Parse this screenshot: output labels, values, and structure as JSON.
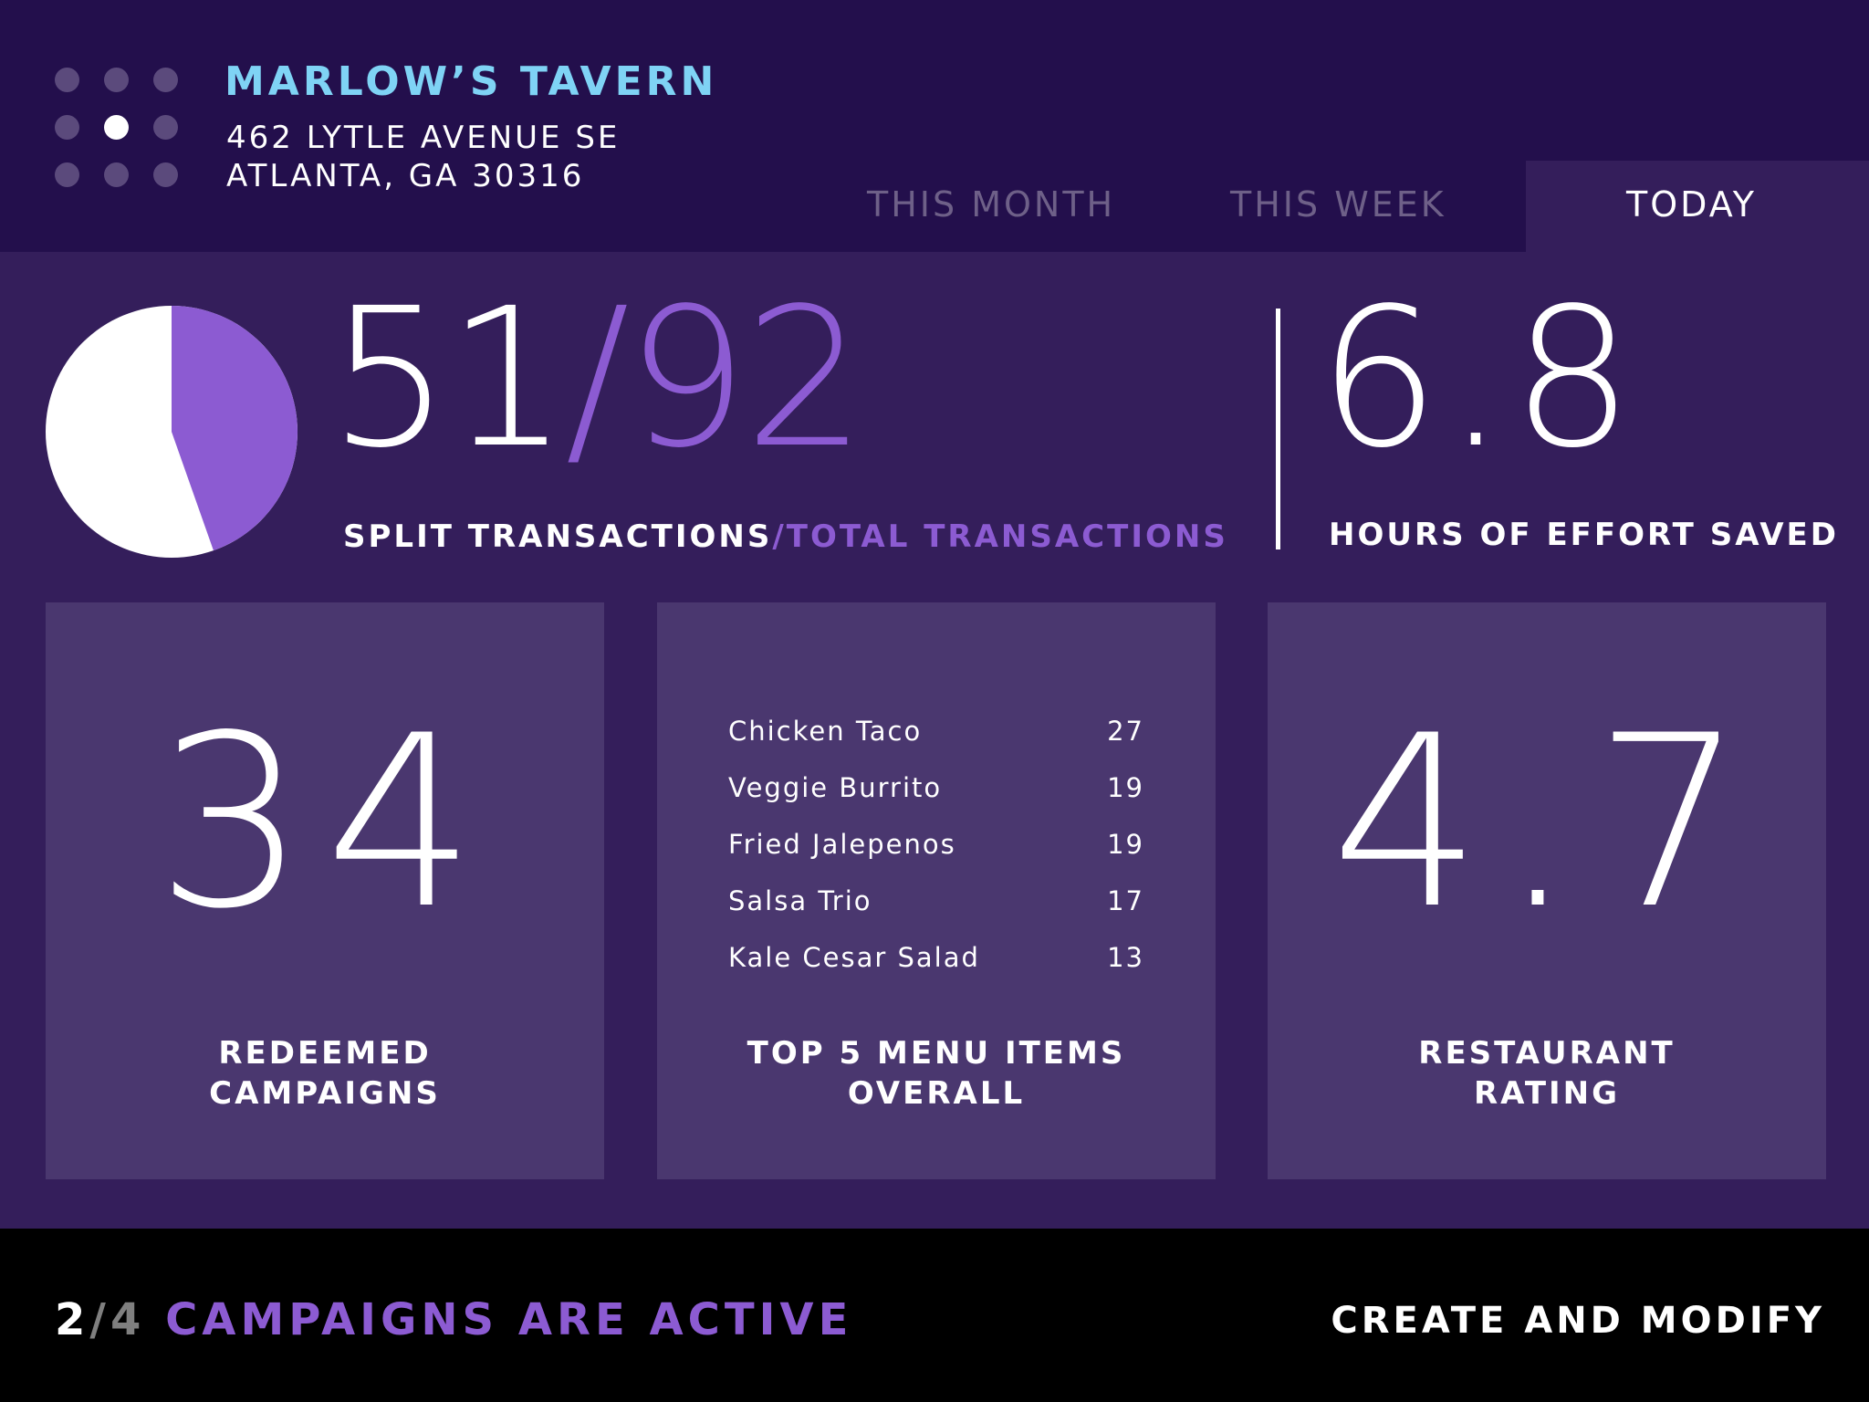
{
  "venue": {
    "name": "MARLOW’S TAVERN",
    "address_line1": "462 LYTLE AVENUE SE",
    "address_line2": "ATLANTA, GA 30316"
  },
  "location_switcher": {
    "total": 9,
    "active_index": 4
  },
  "tabs": [
    {
      "label": "THIS MONTH",
      "selected": false
    },
    {
      "label": "THIS WEEK",
      "selected": false
    },
    {
      "label": "TODAY",
      "selected": true
    }
  ],
  "split_stats": {
    "split": "51",
    "separator": "/",
    "total": "92",
    "label_split": "SPLIT TRANSACTIONS",
    "label_sep": "/",
    "label_total": "TOTAL TRANSACTIONS",
    "split_fraction": 0.446
  },
  "hours_saved": {
    "value": "6.8",
    "label": "HOURS OF EFFORT SAVED"
  },
  "cards": {
    "redeemed": {
      "value": "34",
      "label_line1": "REDEEMED",
      "label_line2": "CAMPAIGNS"
    },
    "top_items": {
      "label_line1": "TOP 5 MENU ITEMS",
      "label_line2": "OVERALL",
      "items": [
        {
          "name": "Chicken Taco",
          "count": "27"
        },
        {
          "name": "Veggie Burrito",
          "count": "19"
        },
        {
          "name": "Fried Jalepenos",
          "count": "19"
        },
        {
          "name": "Salsa Trio",
          "count": "17"
        },
        {
          "name": "Kale Cesar Salad",
          "count": "13"
        }
      ]
    },
    "rating": {
      "value": "4.7",
      "label_line1": "RESTAURANT",
      "label_line2": "RATING"
    }
  },
  "footer": {
    "active_count": "2",
    "separator": "/",
    "total_count": "4",
    "status_text": "CAMPAIGNS ARE ACTIVE",
    "action_label": "CREATE AND MODIFY"
  },
  "colors": {
    "header_bg": "#230f4c",
    "page_bg": "#341e5b",
    "card_bg": "#4a376f",
    "accent_purple": "#8c5bd2",
    "accent_cyan": "#7fd3f5",
    "footer_bg": "#000000"
  }
}
